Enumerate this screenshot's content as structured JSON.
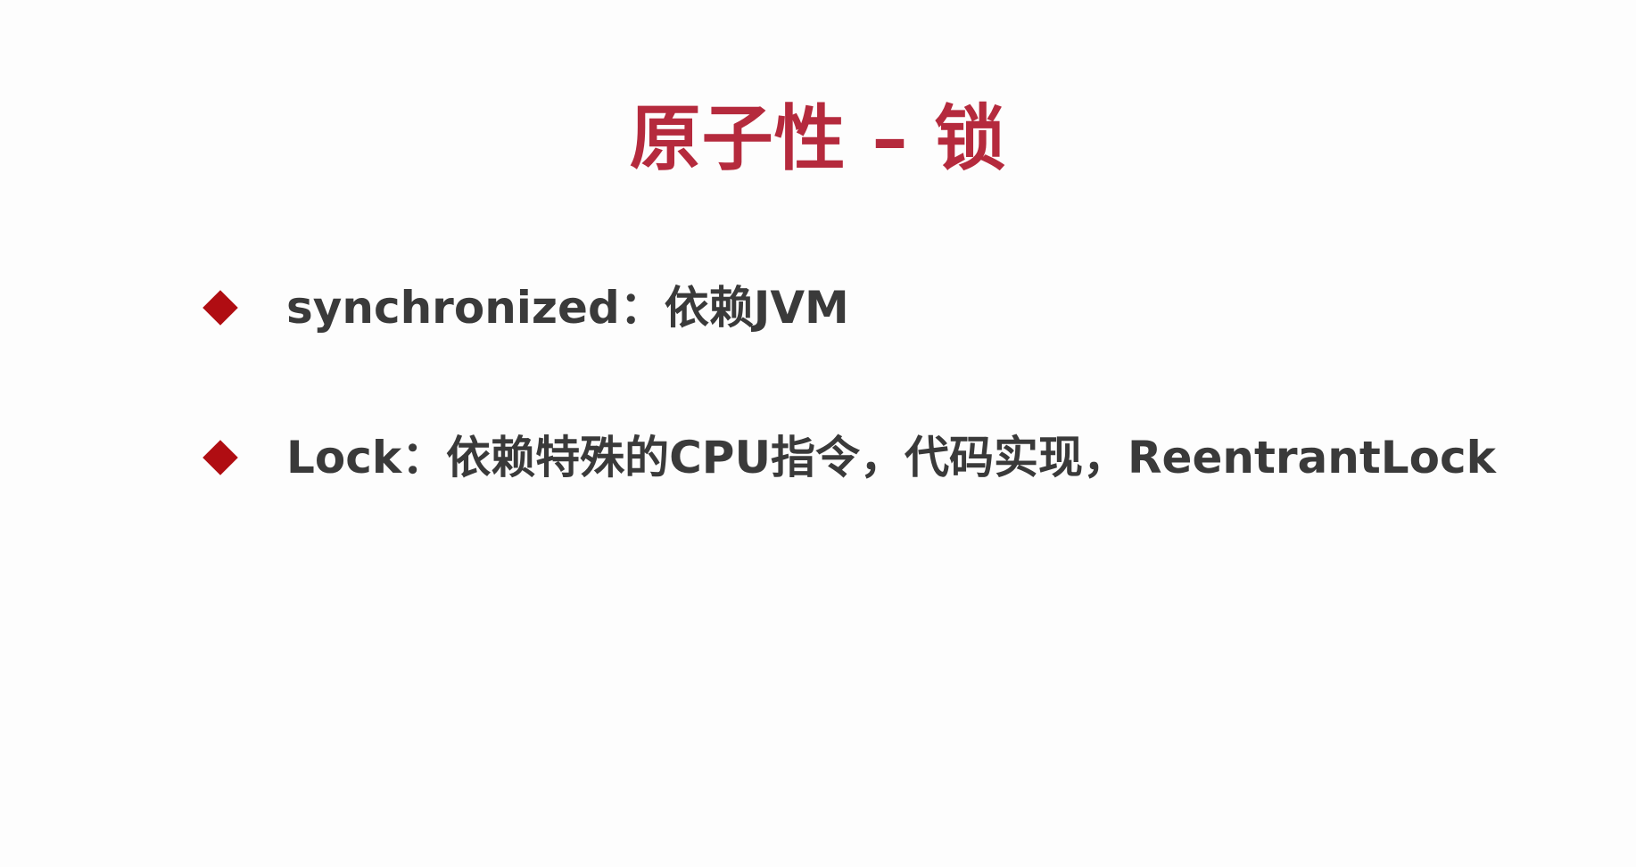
{
  "slide": {
    "title": "原子性 – 锁",
    "bullets": [
      {
        "text": "synchronized：依赖JVM",
        "icon": "diamond-bullet-icon"
      },
      {
        "text": "Lock：依赖特殊的CPU指令，代码实现，ReentrantLock",
        "icon": "diamond-bullet-icon"
      }
    ]
  },
  "colors": {
    "title": "#b52a3d",
    "bullet_marker": "#b00d12",
    "body_text": "#3a3a3a",
    "background": "#fdfdfd"
  }
}
